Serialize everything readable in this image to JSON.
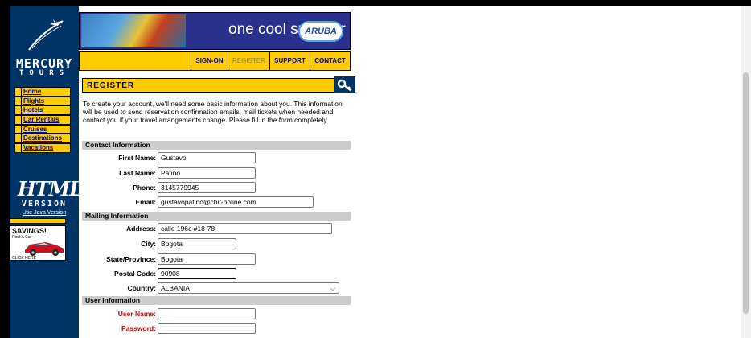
{
  "site": {
    "logo_text": "MERCURY",
    "logo_sub": "TOURS"
  },
  "banner": {
    "tagline": "one cool summer",
    "brand": "ARUBA"
  },
  "top_nav": [
    "SIGN-ON",
    "REGISTER",
    "SUPPORT",
    "CONTACT"
  ],
  "side_nav": [
    "Home",
    "Flights",
    "Hotels",
    "Car Rentals",
    "Cruises",
    "Destinations",
    "Vacations"
  ],
  "html_version": {
    "badge": "HTML",
    "version": "VERSION",
    "java_link": "Use Java Version"
  },
  "promo": {
    "title": "SAVINGS!",
    "sub": "Rent A Car",
    "click": "CLICK HERE"
  },
  "page": {
    "title": "REGISTER",
    "intro": "To create your account, we'll need some basic information about you. This information will be used to send reservation confirmation emails, mail tickets when needed and contact you if your travel arrangements change. Please fill in the form completely."
  },
  "form": {
    "contact_header": "Contact Information",
    "mailing_header": "Mailing Information",
    "user_header": "User Information",
    "labels": {
      "first_name": "First Name:",
      "last_name": "Last Name:",
      "phone": "Phone:",
      "email": "Email:",
      "address": "Address:",
      "city": "City:",
      "state": "State/Province:",
      "postal": "Postal Code:",
      "country": "Country:",
      "user_name": "User Name:",
      "password": "Password:"
    },
    "values": {
      "first_name": "Gustavo",
      "last_name": "Patiño",
      "phone": "3145779945",
      "email": "gustavopatino@cbit-online.com",
      "address": "calle 196c #18-78",
      "city": "Bogota",
      "state": "Bogota",
      "postal": "90908",
      "country": "ALBANIA",
      "user_name": "",
      "password": ""
    }
  },
  "colors": {
    "sidebar": "#003366",
    "accent": "#ffcc00",
    "link": "#000080",
    "required_label": "#cc0000"
  }
}
